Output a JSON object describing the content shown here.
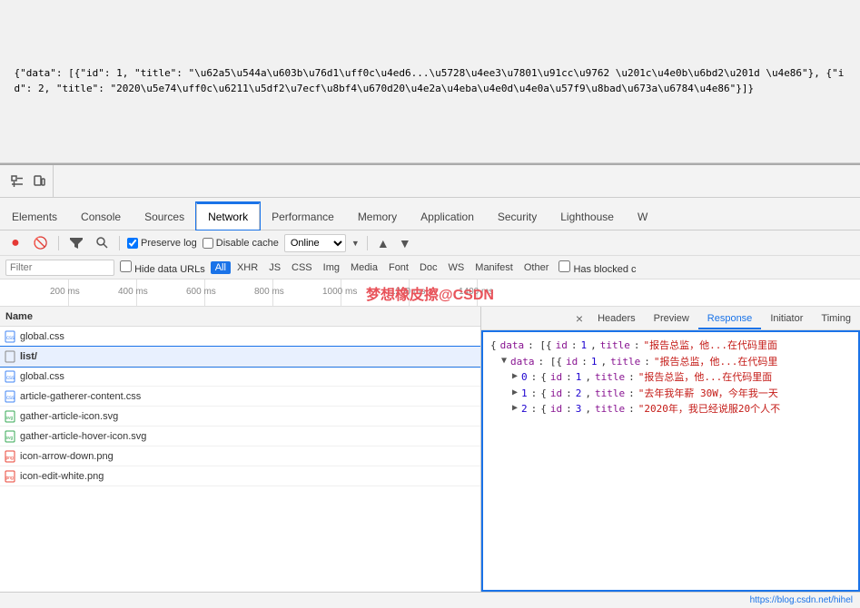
{
  "browser": {
    "json_content": "{\"data\": [{\"id\": 1, \"title\": \"\\u62a5\\u544a\\u603b\\u76d1\\uff0c\\u4ed6...\\u5728\\u4ee3\\u7801\\u91cc\\u9762 \\u201c\\u4e0b\\u6bd2\\u201d \\u4e86\"}, {\"id\": 2, \"title\": \"2020\\u5e74\\uff0c\\u6211\\u5df2\\u7ecf\\u8bf4\\u670d20\\u4e2a\\u4eba\\u4e0d\\u4e0a\\u57f9\\u8bad\\u673a\\u6784\\u4e86\"}]}"
  },
  "devtools": {
    "tabs": [
      {
        "label": "Elements",
        "active": false
      },
      {
        "label": "Console",
        "active": false
      },
      {
        "label": "Sources",
        "active": false
      },
      {
        "label": "Network",
        "active": true
      },
      {
        "label": "Performance",
        "active": false
      },
      {
        "label": "Memory",
        "active": false
      },
      {
        "label": "Application",
        "active": false
      },
      {
        "label": "Security",
        "active": false
      },
      {
        "label": "Lighthouse",
        "active": false
      },
      {
        "label": "W",
        "active": false
      }
    ]
  },
  "network_bar": {
    "preserve_log_label": "Preserve log",
    "disable_cache_label": "Disable cache",
    "online_label": "Online",
    "preserve_log_checked": true,
    "disable_cache_checked": false
  },
  "filter_bar": {
    "filter_placeholder": "Filter",
    "hide_data_urls_label": "Hide data URLs",
    "hide_data_urls_checked": false,
    "types": [
      "All",
      "XHR",
      "JS",
      "CSS",
      "Img",
      "Media",
      "Font",
      "Doc",
      "WS",
      "Manifest",
      "Other"
    ],
    "active_type": "All",
    "has_blocked_label": "Has blocked c"
  },
  "timeline": {
    "ticks": [
      "200 ms",
      "400 ms",
      "600 ms",
      "800 ms",
      "1000 ms",
      "1200 ms",
      "1400 ms",
      "1"
    ]
  },
  "file_list": {
    "header": "Name",
    "files": [
      {
        "name": "global.css",
        "type": "css",
        "selected": false
      },
      {
        "name": "list/",
        "type": "page",
        "selected": true
      },
      {
        "name": "global.css",
        "type": "css",
        "selected": false
      },
      {
        "name": "article-gatherer-content.css",
        "type": "css",
        "selected": false
      },
      {
        "name": "gather-article-icon.svg",
        "type": "svg",
        "selected": false
      },
      {
        "name": "gather-article-hover-icon.svg",
        "type": "svg",
        "selected": false
      },
      {
        "name": "icon-arrow-down.png",
        "type": "png",
        "selected": false
      },
      {
        "name": "icon-edit-white.png",
        "type": "png",
        "selected": false
      }
    ]
  },
  "response_panel": {
    "tabs": [
      "Headers",
      "Preview",
      "Response",
      "Initiator",
      "Timing"
    ],
    "active_tab": "Response",
    "close_icon": "×",
    "content": {
      "line1": "{data: [{id: 1, title: \"报告总监，他...在代码里面",
      "line2": "▼ data: [{id: 1, title: \"报告总监，他...在代码里",
      "line3": "▶ 0: {id: 1, title: \"报告总监，他...在代码里面",
      "line4": "▶ 1: {id: 2, title: \"去年我年薪 30W，今年我一天",
      "line5": "▶ 2: {id: 3, title: \"2020年，我已经说服20个人不"
    }
  },
  "watermark": {
    "text": "梦想橡皮擦@CSDN"
  },
  "status_bar": {
    "url": "https://blog.csdn.net/hihel"
  }
}
